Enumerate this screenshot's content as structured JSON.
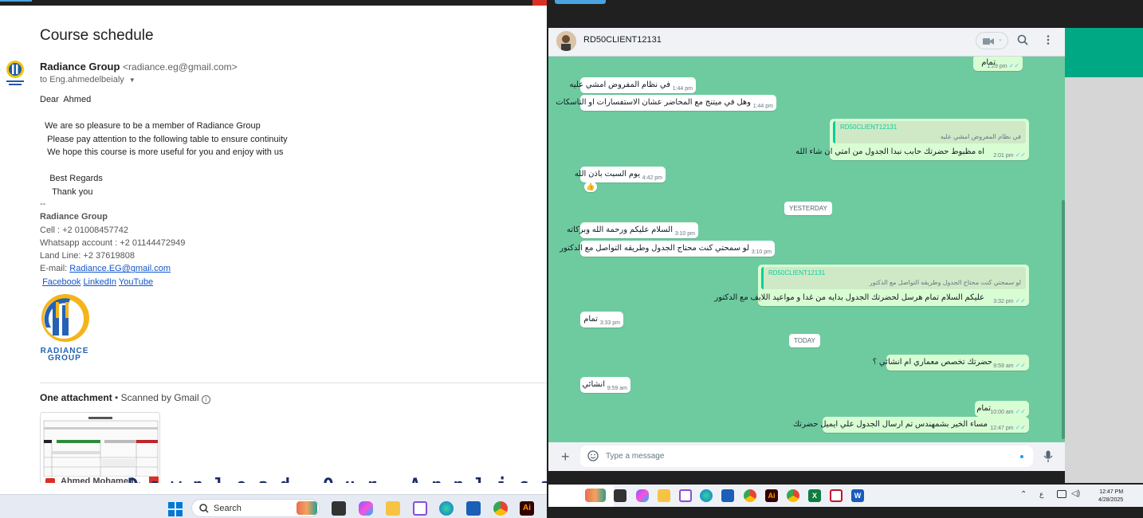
{
  "gmail": {
    "subject": "Course schedule",
    "sender_name": "Radiance Group",
    "sender_email": "<radiance.eg@gmail.com>",
    "to_line": "to Eng.ahmedelbeialy",
    "body_lines": [
      "Dear  Ahmed",
      "",
      "  We are so pleasure to be a member of Radiance Group",
      "   Please pay attention to the following table to ensure continuity",
      "   We hope this course is more useful for you and enjoy with us",
      "",
      "    Best Regards",
      "     Thank you"
    ],
    "signature": {
      "dash": "--",
      "company": "Radiance Group",
      "cell": "Cell : +2 01008457742",
      "whatsapp": "Whatsapp account : +2 01144472949",
      "landline": "Land Line: +2 37619808",
      "email_label": "E-mail: ",
      "email_link": "Radiance.EG@gmail.com",
      "links": [
        "Facebook",
        "LinkedIn",
        "YouTube"
      ]
    },
    "logo_text": [
      "RADIANCE",
      "GROUP"
    ],
    "attachment_title": "One attachment",
    "scanned": "• Scanned by Gmail",
    "attachment_name": "Ahmed Mohamed...",
    "overlay_text": "Download Our Applica"
  },
  "taskbar_left": {
    "search_label": "Search"
  },
  "whatsapp": {
    "contact_name": "RD50CLIENT12131",
    "input_placeholder": "Type a message",
    "messages": [
      {
        "dir": "out",
        "text": "تمام",
        "time": "1:29 pm"
      },
      {
        "dir": "in",
        "text": "في نظام المفروض امشي عليه",
        "time": "1:44 pm"
      },
      {
        "dir": "in",
        "text": "وهل في ميتنج مع المحاضر عشان الاستفسارات او التاسكات",
        "time": "1:44 pm"
      },
      {
        "dir": "out",
        "quote_author": "RD50CLIENT12131",
        "quote_text": "في نظام المفروض امشي عليه",
        "text": "اه مظبوط حضرتك حابب نبدا الجدول من امتي ان شاء الله",
        "time": "2:01 pm"
      },
      {
        "dir": "in",
        "text": "يوم السبت باذن الله",
        "time": "4:42 pm",
        "reaction": "👍"
      },
      {
        "dir": "in",
        "text": "السلام عليكم ورحمة الله وبركاته",
        "time": "3:10 pm"
      },
      {
        "dir": "in",
        "text": "لو سمحتي كنت محتاج الجدول وطريقه التواصل مع الدكتور",
        "time": "3:10 pm"
      },
      {
        "dir": "out",
        "quote_author": "RD50CLIENT12131",
        "quote_text": "لو سمحتي كنت محتاج الجدول وطريقه التواصل مع الدكتور",
        "text": "عليكم السلام تمام هرسل لحضرتك الجدول بدايه من غدا و مواعيد اللايف مع الدكتور",
        "time": "3:32 pm"
      },
      {
        "dir": "in",
        "text": "تمام",
        "time": "3:33 pm"
      },
      {
        "dir": "out",
        "text": "حضرتك تخصص معماري ام انشائي ؟",
        "time": "9:59 am"
      },
      {
        "dir": "in",
        "text": "انشائي",
        "time": "9:59 am"
      },
      {
        "dir": "out",
        "text": "تمام",
        "time": "10:00 am"
      },
      {
        "dir": "out",
        "text": "مساء الخير بشمهندس تم ارسال الجدول علي ايميل حضرتك",
        "time": "12:47 pm"
      }
    ],
    "day_labels": [
      "YESTERDAY",
      "TODAY"
    ]
  },
  "clock": {
    "time": "12:47 PM",
    "date": "4/28/2025"
  },
  "tray": {
    "lang": "ع"
  },
  "colors": {
    "chat_bg": "#6ecba0",
    "outgoing_bubble": "#d9fdd3",
    "incoming_bubble": "#ffffff",
    "wa_green": "#00a884",
    "link_blue": "#1155cc"
  }
}
